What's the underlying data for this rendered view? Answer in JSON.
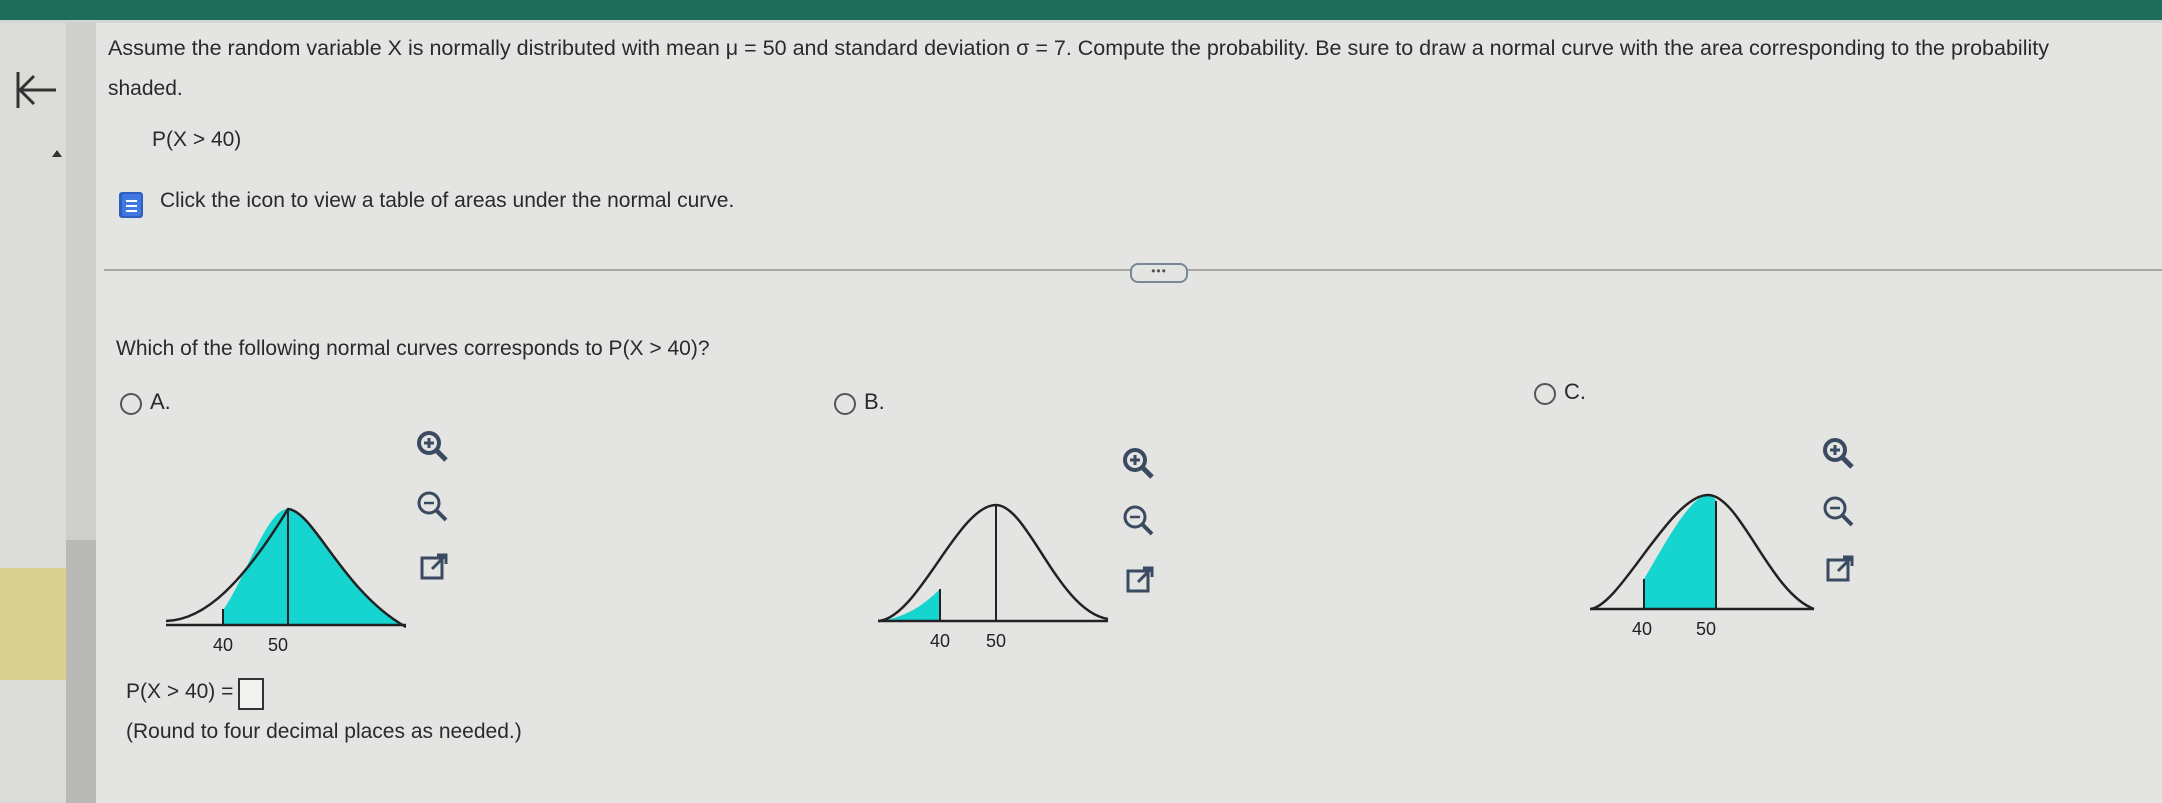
{
  "question": {
    "line1": "Assume the random variable X is normally distributed with mean μ = 50 and standard deviation σ = 7. Compute the probability. Be sure to draw a normal curve with the area corresponding to the probability",
    "line2": "shaded.",
    "expression": "P(X > 40)",
    "table_link": "Click the icon to view a table of areas under the normal curve."
  },
  "more_button": "•••",
  "sub_question": "Which of the following normal curves corresponds to P(X > 40)?",
  "options": [
    {
      "label": "A.",
      "shading": "right of 40",
      "tick_labels": [
        "40",
        "50"
      ]
    },
    {
      "label": "B.",
      "shading": "left of 40",
      "tick_labels": [
        "40",
        "50"
      ]
    },
    {
      "label": "C.",
      "shading": "between 40 and 50",
      "tick_labels": [
        "40",
        "50"
      ]
    }
  ],
  "graph_tools": [
    "zoom-in-icon",
    "zoom-out-icon",
    "open-external-icon"
  ],
  "answer": {
    "label": "P(X > 40) =",
    "value": "",
    "hint": "(Round to four decimal places as needed.)"
  },
  "colors": {
    "shade": "#16d4d0",
    "top_bar": "#1e6d5a",
    "background": "#e4e4e2"
  }
}
